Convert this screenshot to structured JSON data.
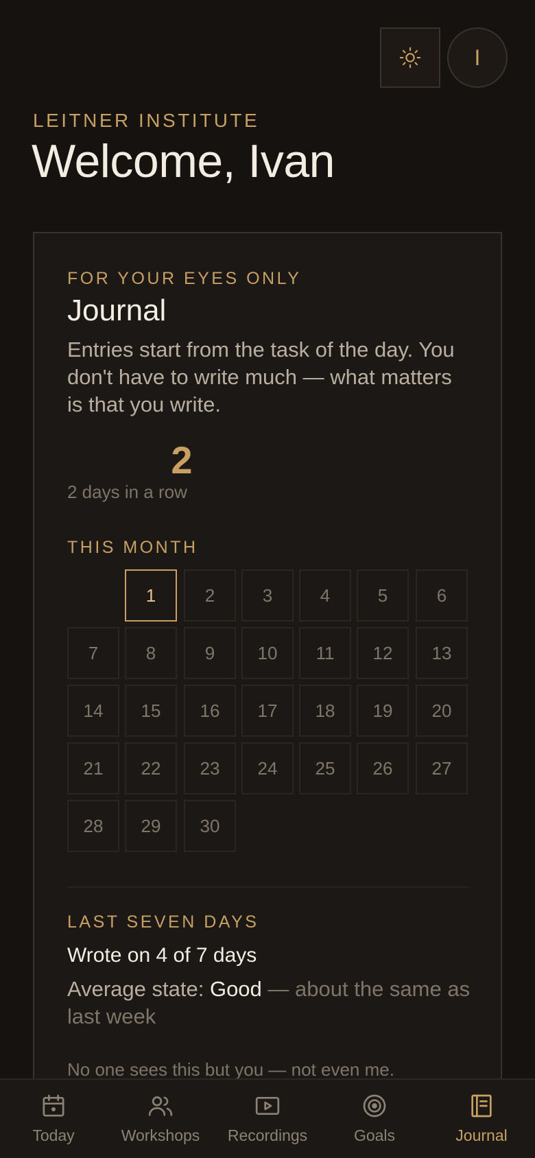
{
  "header": {
    "theme_icon": "sun-icon",
    "avatar_initial": "I",
    "org_name": "LEITNER INSTITUTE",
    "welcome": "Welcome, Ivan"
  },
  "journal": {
    "kicker": "FOR YOUR EYES ONLY",
    "title": "Journal",
    "description": "Entries start from the task of the day. You don't have to write much — what matters is that you write.",
    "streak_count": "2",
    "streak_label": "2 days in a row",
    "month_heading": "THIS MONTH",
    "today": 1,
    "month_days": [
      "1",
      "2",
      "3",
      "4",
      "5",
      "6",
      "7",
      "8",
      "9",
      "10",
      "11",
      "12",
      "13",
      "14",
      "15",
      "16",
      "17",
      "18",
      "19",
      "20",
      "21",
      "22",
      "23",
      "24",
      "25",
      "26",
      "27",
      "28",
      "29",
      "30"
    ],
    "week_heading": "LAST SEVEN DAYS",
    "wrote_summary": "Wrote on 4 of 7 days",
    "avg_prefix": "Average state: ",
    "avg_value": "Good",
    "avg_suffix": " — about the same as last week",
    "privacy_note": "No one sees this but you — not even me."
  },
  "nav": {
    "items": [
      {
        "label": "Today",
        "icon": "calendar-icon"
      },
      {
        "label": "Workshops",
        "icon": "people-icon"
      },
      {
        "label": "Recordings",
        "icon": "play-icon"
      },
      {
        "label": "Goals",
        "icon": "target-icon"
      },
      {
        "label": "Journal",
        "icon": "journal-icon"
      }
    ],
    "active": "Journal"
  },
  "colors": {
    "background": "#151210",
    "accent": "#c9a063",
    "card": "#1c1815"
  }
}
